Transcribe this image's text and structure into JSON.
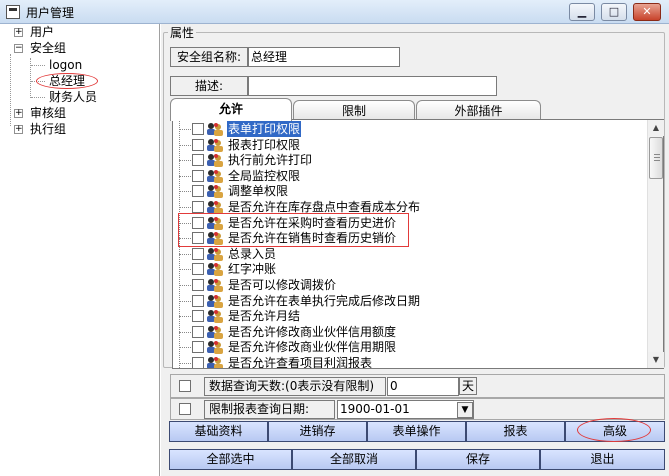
{
  "window": {
    "title": "用户管理"
  },
  "tree": {
    "items": [
      {
        "label": "用户"
      },
      {
        "label": "安全组"
      },
      {
        "label": "logon"
      },
      {
        "label": "总经理"
      },
      {
        "label": "财务人员"
      },
      {
        "label": "审核组"
      },
      {
        "label": "执行组"
      }
    ]
  },
  "properties": {
    "group_title": "属性",
    "name_label": "安全组名称:",
    "name_value": "总经理",
    "desc_label": "描述:",
    "desc_value": ""
  },
  "tabs": [
    {
      "label": "允许",
      "active": true
    },
    {
      "label": "限制"
    },
    {
      "label": "外部插件"
    }
  ],
  "permissions": [
    {
      "label": "表单打印权限",
      "selected": true
    },
    {
      "label": "报表打印权限"
    },
    {
      "label": "执行前允许打印"
    },
    {
      "label": "全局监控权限"
    },
    {
      "label": "调整单权限"
    },
    {
      "label": "是否允许在库存盘点中查看成本分布"
    },
    {
      "label": "是否允许在采购时查看历史进价"
    },
    {
      "label": "是否允许在销售时查看历史销价"
    },
    {
      "label": "总录入员"
    },
    {
      "label": "红字冲账"
    },
    {
      "label": "是否可以修改调拨价"
    },
    {
      "label": "是否允许在表单执行完成后修改日期"
    },
    {
      "label": "是否允许月结"
    },
    {
      "label": "是否允许修改商业伙伴信用额度"
    },
    {
      "label": "是否允许修改商业伙伴信用期限"
    },
    {
      "label": "是否允许查看项目利润报表"
    }
  ],
  "options": {
    "query_days_label": "数据查询天数:(0表示没有限制)",
    "query_days_value": "0",
    "query_days_unit": "天",
    "report_date_label": "限制报表查询日期:",
    "report_date_value": "1900-01-01"
  },
  "category_buttons": [
    "基础资料",
    "进销存",
    "表单操作",
    "报表",
    "高级"
  ],
  "action_buttons": [
    "全部选中",
    "全部取消",
    "保存",
    "退出"
  ],
  "icons": {
    "app": "app-window-icon",
    "minimize": "minimize-icon",
    "maximize": "maximize-icon",
    "close": "close-icon",
    "permission": "user-group-icon"
  }
}
